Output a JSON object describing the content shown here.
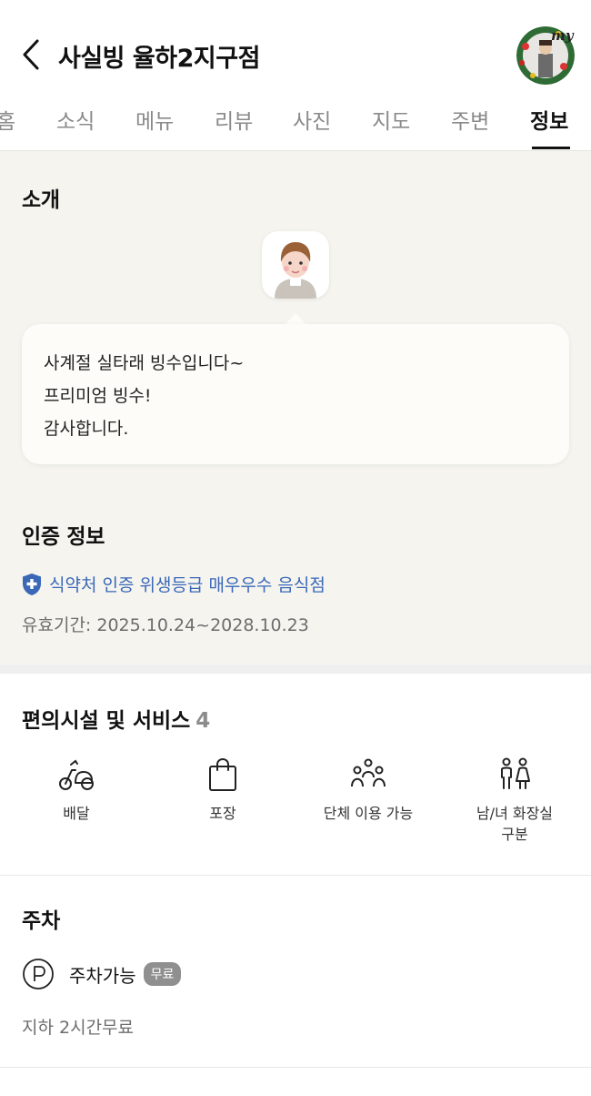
{
  "header": {
    "title": "사실빙 율하2지구점",
    "avatar_badge": "my"
  },
  "tabs": [
    {
      "label": "홈",
      "active": false
    },
    {
      "label": "소식",
      "active": false
    },
    {
      "label": "메뉴",
      "active": false
    },
    {
      "label": "리뷰",
      "active": false
    },
    {
      "label": "사진",
      "active": false
    },
    {
      "label": "지도",
      "active": false
    },
    {
      "label": "주변",
      "active": false
    },
    {
      "label": "정보",
      "active": true
    }
  ],
  "intro": {
    "title": "소개",
    "lines": [
      "사계절 실타래 빙수입니다~",
      "프리미엄 빙수!",
      "감사합니다."
    ]
  },
  "certification": {
    "title": "인증 정보",
    "label": "식약처 인증 위생등급 매우우수 음식점",
    "validity": "유효기간: 2025.10.24~2028.10.23",
    "color": "#3a68b7"
  },
  "facilities": {
    "title": "편의시설 및 서비스",
    "count": "4",
    "items": [
      {
        "label": "배달",
        "icon": "scooter-icon"
      },
      {
        "label": "포장",
        "icon": "shopping-bag-icon"
      },
      {
        "label": "단체 이용 가능",
        "icon": "group-icon"
      },
      {
        "label": "남/녀 화장실\n구분",
        "label_line1": "남/녀 화장실",
        "label_line2": "구분",
        "icon": "restroom-icon"
      }
    ]
  },
  "parking": {
    "title": "주차",
    "label": "주차가능",
    "badge": "무료",
    "description": "지하 2시간무료"
  }
}
